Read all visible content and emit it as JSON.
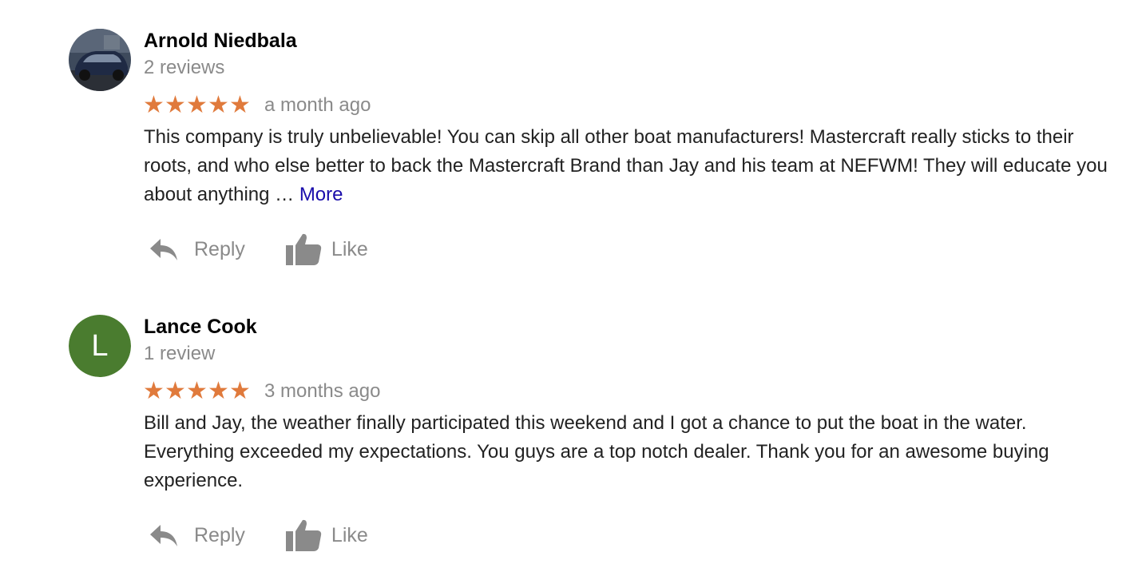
{
  "reviews": [
    {
      "author": "Arnold Niedbala",
      "review_count": "2 reviews",
      "rating": 5,
      "stars": "★★★★★",
      "date": "a month ago",
      "text": "This company is truly unbelievable! You can skip all other boat manufacturers! Mastercraft really sticks to their roots, and who else better to back the Mastercraft Brand than Jay and his team at NEFWM! They will educate you about anything …",
      "more_label": "More",
      "avatar": {
        "type": "photo",
        "icon": "car-photo-avatar"
      },
      "actions": {
        "reply_label": "Reply",
        "like_label": "Like"
      }
    },
    {
      "author": "Lance Cook",
      "review_count": "1 review",
      "rating": 5,
      "stars": "★★★★★",
      "date": "3 months ago",
      "text": "Bill and Jay, the weather finally participated this weekend and I got a chance to put the boat in the water. Everything exceeded my expectations. You guys are a top notch dealer. Thank you for an awesome buying experience.",
      "avatar": {
        "type": "letter",
        "letter": "L",
        "color": "#4a7c2f"
      },
      "actions": {
        "reply_label": "Reply",
        "like_label": "Like"
      }
    }
  ],
  "colors": {
    "star": "#e07a3c",
    "muted_text": "#8a8a8a",
    "link": "#1a0dab",
    "icon": "#8a8a8a"
  }
}
